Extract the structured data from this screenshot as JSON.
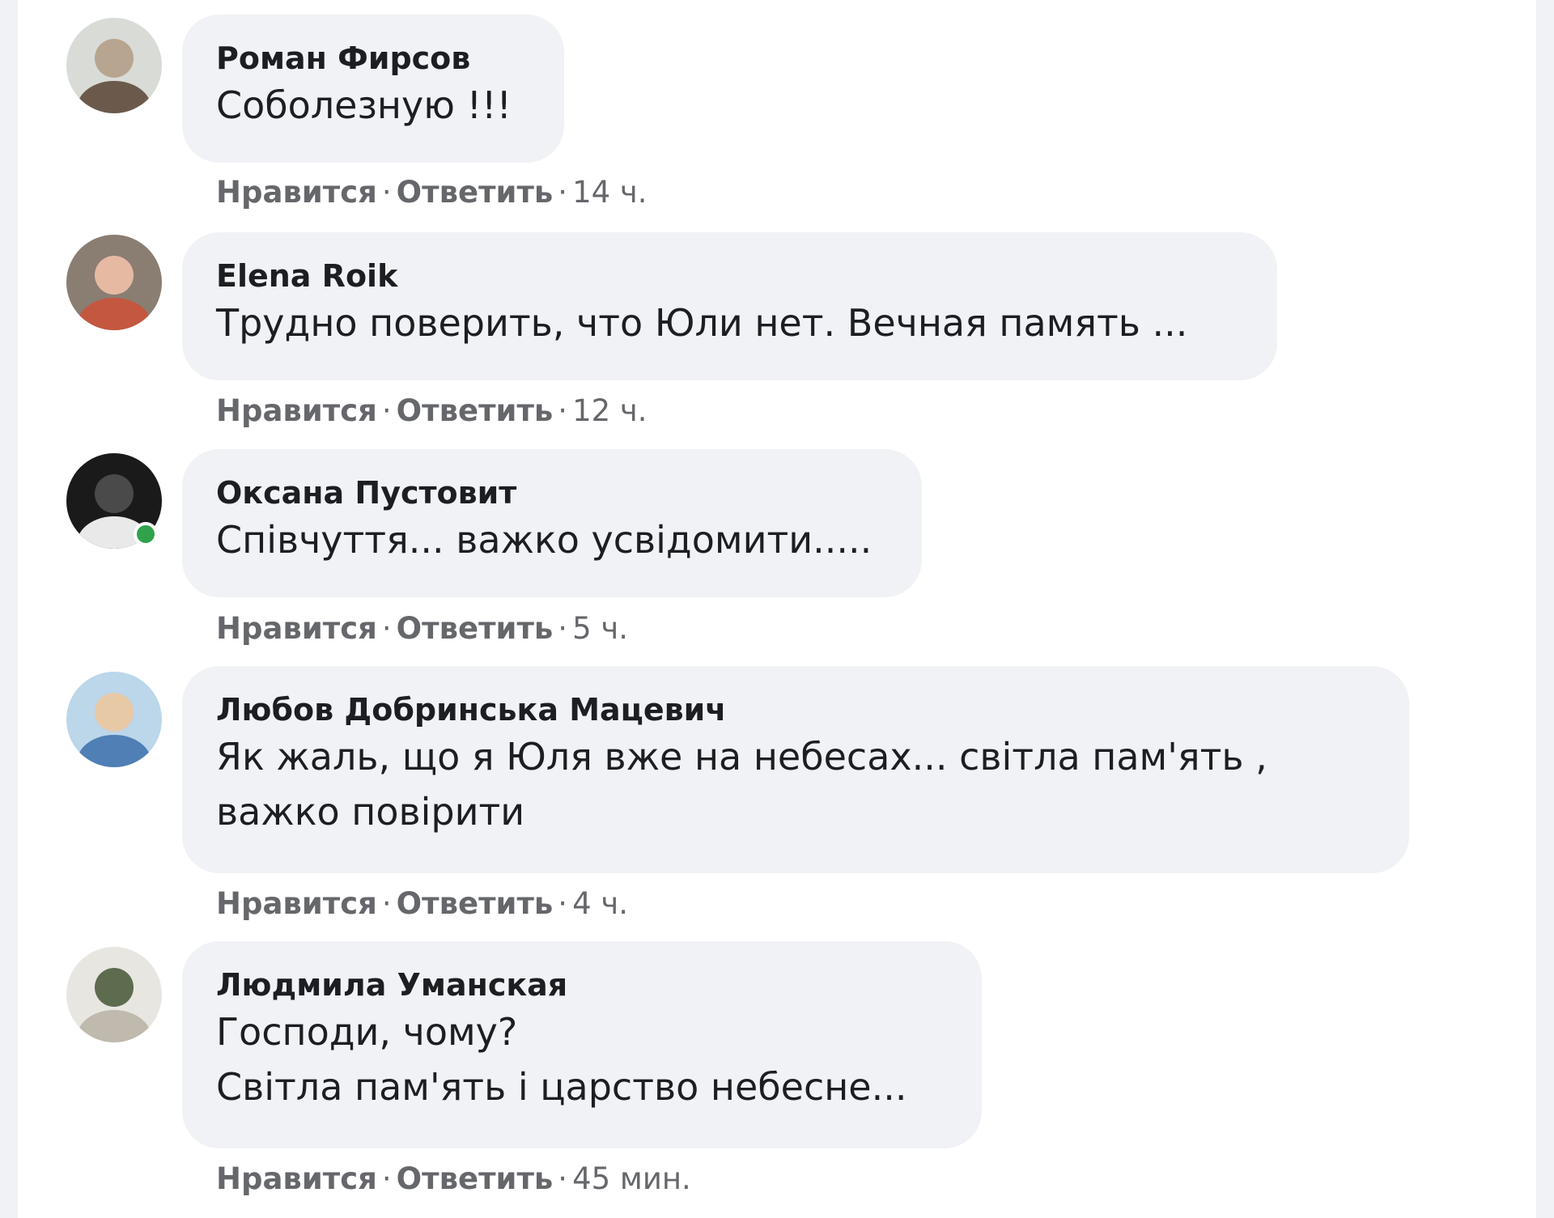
{
  "comments": [
    {
      "author": "Роман Фирсов",
      "lines": [
        "Соболезную !!!"
      ],
      "like": "Нравится",
      "reply": "Ответить",
      "time": "14 ч.",
      "online": false,
      "avatar_colors": [
        "#d9dbd7",
        "#6b5a4c",
        "#b7a58f"
      ]
    },
    {
      "author": "Elena Roik",
      "lines": [
        "Трудно поверить, что Юли нет. Вечная память ..."
      ],
      "like": "Нравится",
      "reply": "Ответить",
      "time": "12 ч.",
      "online": false,
      "avatar_colors": [
        "#8a7d72",
        "#c4573f",
        "#e6b9a3"
      ]
    },
    {
      "author": "Оксана Пустовит",
      "lines": [
        "Співчуття... важко усвідомити....."
      ],
      "like": "Нравится",
      "reply": "Ответить",
      "time": "5 ч.",
      "online": true,
      "avatar_colors": [
        "#1a1a1a",
        "#e9e9e9",
        "#4a4a4a"
      ]
    },
    {
      "author": "Любов Добринська Мацевич",
      "lines": [
        "Як жаль, що я Юля вже на небесах... світла пам'ять ,",
        "важко повірити"
      ],
      "like": "Нравится",
      "reply": "Ответить",
      "time": "4 ч.",
      "online": false,
      "avatar_colors": [
        "#bcd6ea",
        "#4f7fb5",
        "#e7c9a6"
      ]
    },
    {
      "author": "Людмила Уманская",
      "lines": [
        "Господи, чому?",
        "Світла пам'ять і царство небесне..."
      ],
      "like": "Нравится",
      "reply": "Ответить",
      "time": "45 мин.",
      "online": false,
      "avatar_colors": [
        "#e8e6e1",
        "#bfb9ae",
        "#5d6b4f"
      ]
    }
  ]
}
